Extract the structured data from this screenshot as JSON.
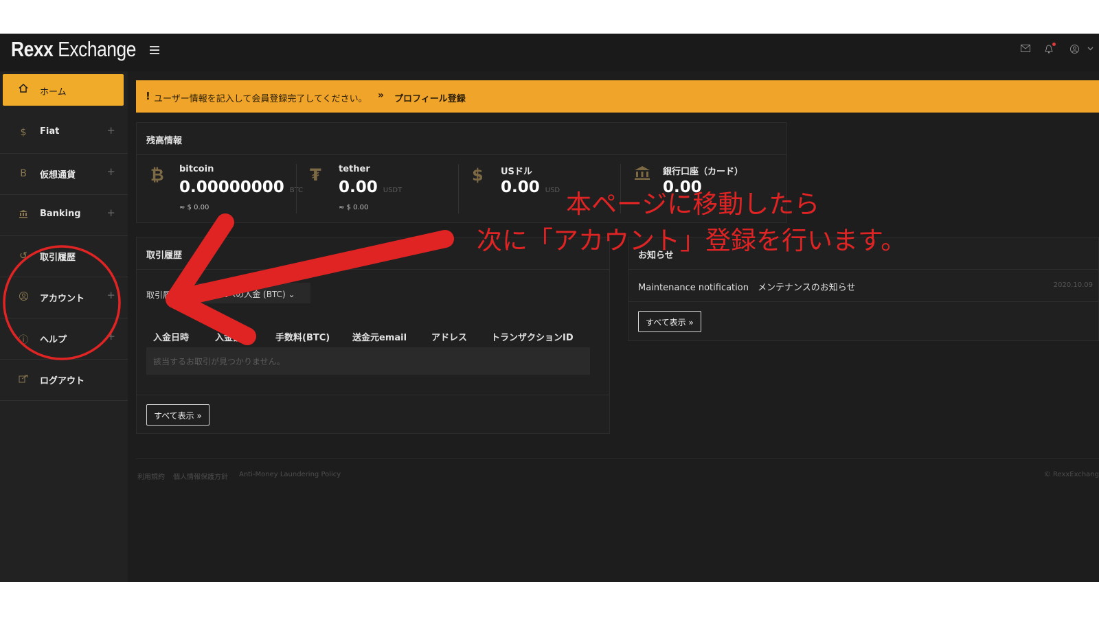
{
  "app": {
    "logo_bold": "Rexx",
    "logo_rest": " Exchange"
  },
  "topbar": {
    "icons": [
      "menu-icon",
      "mail-icon",
      "bell-icon",
      "user-icon",
      "chevron-down-icon"
    ]
  },
  "sidebar": {
    "items": [
      {
        "label": "ホーム",
        "icon": "home-icon",
        "active": true
      },
      {
        "label": "Fiat",
        "icon": "dollar-icon",
        "expandable": true
      },
      {
        "label": "仮想通貨",
        "icon": "bitcoin-icon",
        "expandable": true
      },
      {
        "label": "Banking",
        "icon": "bank-icon",
        "expandable": true
      },
      {
        "label": "取引履歴",
        "icon": "history-icon",
        "expandable": false
      },
      {
        "label": "アカウント",
        "icon": "account-icon",
        "expandable": true
      },
      {
        "label": "ヘルプ",
        "icon": "help-icon",
        "expandable": true
      },
      {
        "label": "ログアウト",
        "icon": "logout-icon",
        "expandable": false
      }
    ]
  },
  "alert": {
    "message": "ユーザー情報を記入して会員登録完了してください。",
    "link": "プロフィール登録"
  },
  "balance": {
    "title": "残高情報",
    "items": [
      {
        "name": "bitcoin",
        "amount": "0.00000000",
        "unit": "BTC",
        "approx": "≈ $ 0.00",
        "icon": "bitcoin-icon"
      },
      {
        "name": "tether",
        "amount": "0.00",
        "unit": "USDT",
        "approx": "≈ $ 0.00",
        "icon": "tether-icon"
      },
      {
        "name": "USドル",
        "amount": "0.00",
        "unit": "USD",
        "approx": "",
        "icon": "dollar-icon"
      },
      {
        "name": "銀行口座（カード）",
        "amount": "0.00",
        "unit": "",
        "approx": "",
        "icon": "bank-icon"
      }
    ]
  },
  "history": {
    "title": "取引履歴",
    "filter_label": "取引履",
    "filter_value": "Walletへの入金 (BTC)",
    "columns": [
      "入金日時",
      "入金額",
      "手数料(BTC)",
      "送金元email",
      "アドレス",
      "トランザクションID"
    ],
    "empty": "該当するお取引が見つかりません。",
    "view_all": "すべて表示"
  },
  "notices": {
    "title": "お知らせ",
    "items": [
      {
        "title": "Maintenance notification　メンテナンスのお知らせ",
        "date": "2020.10.09"
      }
    ],
    "view_all": "すべて表示"
  },
  "footer": {
    "links": [
      "利用規約",
      "個人情報保護方針",
      "Anti-Money Laundering Policy"
    ],
    "copyright": "© RexxExchang"
  },
  "annotation": {
    "line1": "本ページに移動したら",
    "line2": "次に「アカウント」登録を行います。",
    "color": "#e02424"
  }
}
